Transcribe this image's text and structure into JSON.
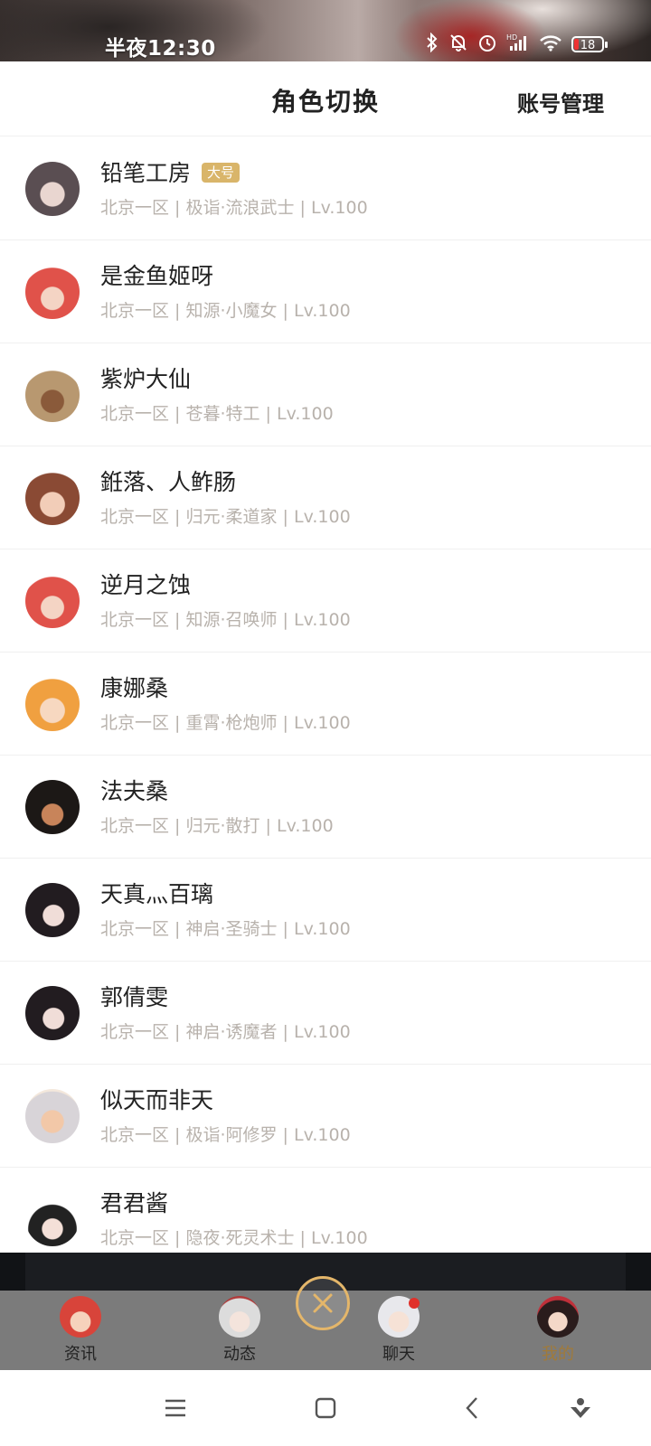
{
  "status_bar": {
    "time": "半夜12:30",
    "battery": "18",
    "icons": [
      "bluetooth-icon",
      "mute-icon",
      "alarm-icon",
      "hd-signal-icon",
      "wifi-icon",
      "battery-icon"
    ]
  },
  "header": {
    "title": "角色切换",
    "right_action": "账号管理"
  },
  "roles": [
    {
      "name": "铅笔工房",
      "badge": "大号",
      "info": "北京一区 | 极诣·流浪武士 | Lv.100",
      "avatar": "silver-hair-female"
    },
    {
      "name": "是金鱼姬呀",
      "badge": "",
      "info": "北京一区 | 知源·小魔女 | Lv.100",
      "avatar": "red-hair-witch"
    },
    {
      "name": "紫炉大仙",
      "badge": "",
      "info": "北京一区 | 苍暮·特工 | Lv.100",
      "avatar": "dark-skin-agent"
    },
    {
      "name": "銋落、人鲊肠",
      "badge": "",
      "info": "北京一区 | 归元·柔道家 | Lv.100",
      "avatar": "brown-hair-fighter"
    },
    {
      "name": "逆月之蚀",
      "badge": "",
      "info": "北京一区 | 知源·召唤师 | Lv.100",
      "avatar": "red-hair-summoner"
    },
    {
      "name": "康娜桑",
      "badge": "",
      "info": "北京一区 | 重霄·枪炮师 | Lv.100",
      "avatar": "blonde-gunner"
    },
    {
      "name": "法夫桑",
      "badge": "",
      "info": "北京一区 | 归元·散打 | Lv.100",
      "avatar": "dark-hair-striker"
    },
    {
      "name": "天真灬百璃",
      "badge": "",
      "info": "北京一区 | 神启·圣骑士 | Lv.100",
      "avatar": "dark-hair-crusader"
    },
    {
      "name": "郭倩雯",
      "badge": "",
      "info": "北京一区 | 神启·诱魔者 | Lv.100",
      "avatar": "dark-hair-temptress"
    },
    {
      "name": "似天而非天",
      "badge": "",
      "info": "北京一区 | 极诣·阿修罗 | Lv.100",
      "avatar": "white-hair-asura"
    },
    {
      "name": "君君酱",
      "badge": "",
      "info": "北京一区 | 隐夜·死灵术士 | Lv.100",
      "avatar": "witch-hat-necromancer"
    }
  ],
  "tabs": [
    {
      "label": "资讯",
      "active": false
    },
    {
      "label": "动态",
      "active": false
    },
    {
      "label": "聊天",
      "active": false,
      "dot": true
    },
    {
      "label": "我的",
      "active": true
    }
  ],
  "system_nav": [
    "menu-icon",
    "home-icon",
    "back-icon",
    "assistant-icon"
  ],
  "colors": {
    "badge": "#d9b56a",
    "info_text": "#b8b2ac",
    "tab_active": "#a07a3a",
    "fab_ring": "#e4b66a"
  }
}
